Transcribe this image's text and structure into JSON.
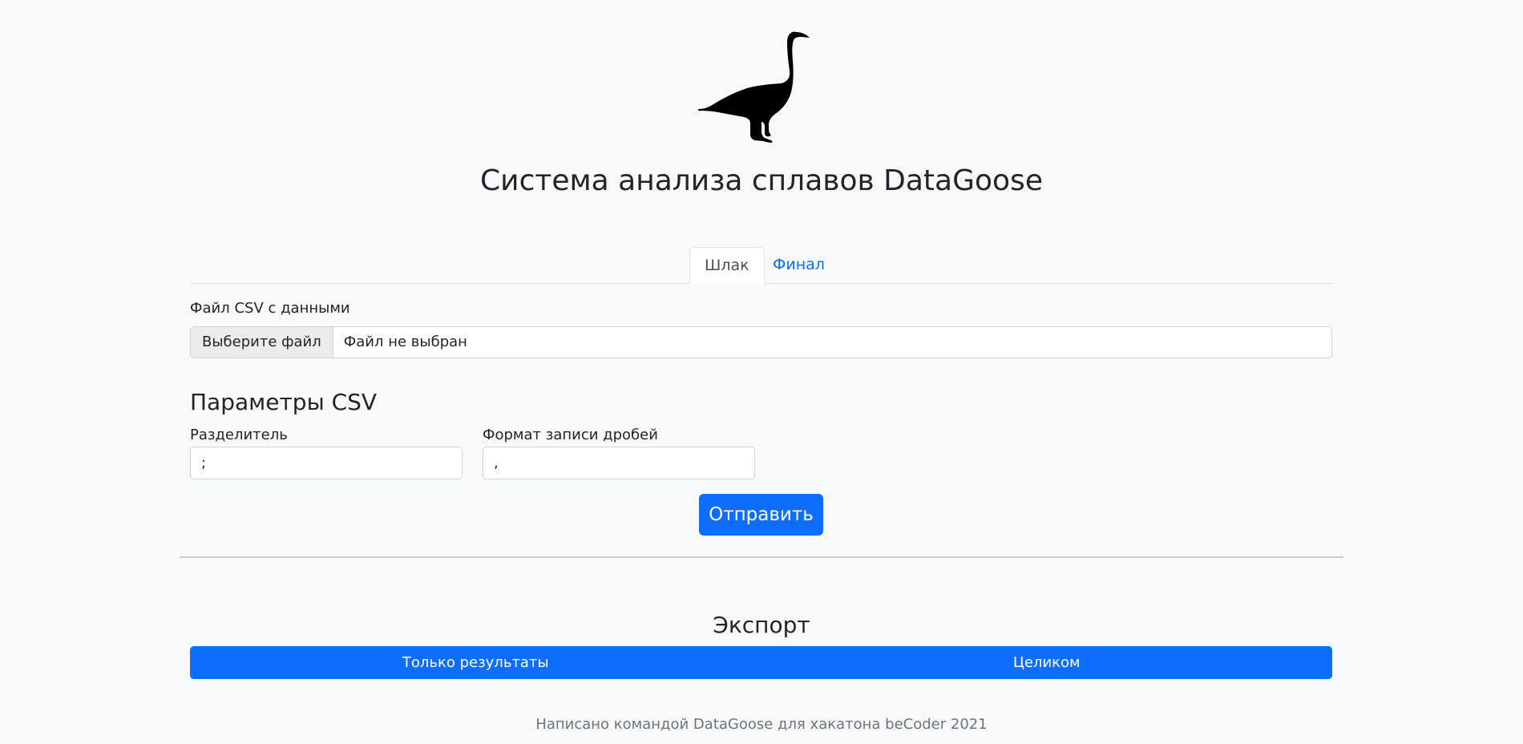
{
  "header": {
    "logo_icon": "goose-icon",
    "title": "Система анализа сплавов DataGoose"
  },
  "tabs": [
    {
      "label": "Шлак",
      "active": true
    },
    {
      "label": "Финал",
      "active": false
    }
  ],
  "form": {
    "file_label": "Файл CSV с данными",
    "file_button": "Выберите файл",
    "file_status": "Файл не выбран",
    "params_title": "Параметры CSV",
    "separator_label": "Разделитель",
    "separator_value": ";",
    "decimal_label": "Формат записи дробей",
    "decimal_value": ",",
    "submit_label": "Отправить"
  },
  "export": {
    "title": "Экспорт",
    "results_only_label": "Только результаты",
    "full_label": "Целиком"
  },
  "footer": {
    "text": "Написано командой DataGoose для хакатона beCoder 2021"
  },
  "colors": {
    "accent": "#0d6efd",
    "background": "#f8f9fa"
  }
}
